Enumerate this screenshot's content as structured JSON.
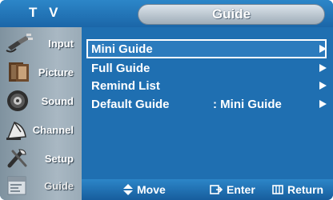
{
  "header": {
    "section_label": "T V",
    "title": "Guide"
  },
  "sidebar": {
    "items": [
      {
        "label": "Input",
        "icon": "input-plug-icon",
        "selected": false
      },
      {
        "label": "Picture",
        "icon": "picture-frame-icon",
        "selected": false
      },
      {
        "label": "Sound",
        "icon": "speaker-icon",
        "selected": false
      },
      {
        "label": "Channel",
        "icon": "satellite-dish-icon",
        "selected": false
      },
      {
        "label": "Setup",
        "icon": "setup-tools-icon",
        "selected": false
      },
      {
        "label": "Guide",
        "icon": "program-guide-icon",
        "selected": true
      }
    ]
  },
  "menu": {
    "items": [
      {
        "label": "Mini Guide",
        "value": "",
        "selected": true
      },
      {
        "label": "Full Guide",
        "value": "",
        "selected": false
      },
      {
        "label": "Remind List",
        "value": "",
        "selected": false
      },
      {
        "label": "Default Guide",
        "value": ": Mini Guide",
        "selected": false
      }
    ]
  },
  "footer": {
    "move_label": "Move",
    "enter_label": "Enter",
    "return_label": "Return"
  },
  "colors": {
    "panel_blue": "#1f6fb1",
    "sidebar_gray": "#a9b8c3",
    "title_pill": "#c5d0da",
    "text": "#ffffff"
  }
}
